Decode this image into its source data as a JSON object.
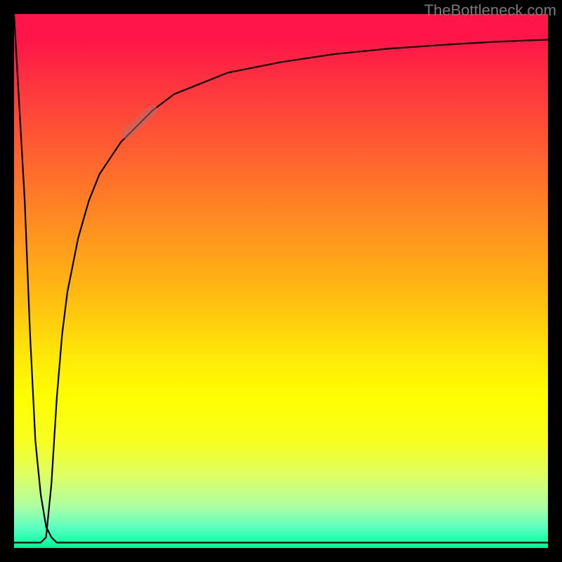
{
  "watermark": "TheBottleneck.com",
  "chart_data": {
    "type": "line",
    "title": "",
    "xlabel": "",
    "ylabel": "",
    "xlim": [
      0,
      100
    ],
    "ylim": [
      0,
      100
    ],
    "grid": false,
    "legend": false,
    "series": [
      {
        "name": "bottleneck-curve",
        "color": "#000000",
        "x": [
          0,
          2,
          3,
          4,
          5,
          6,
          7,
          8,
          9,
          10,
          12,
          14,
          16,
          18,
          20,
          23,
          26,
          30,
          35,
          40,
          50,
          60,
          70,
          80,
          90,
          100
        ],
        "y_down": [
          100,
          65,
          40,
          20,
          10,
          4,
          2,
          1,
          1,
          1,
          1,
          1,
          1,
          1,
          1,
          1,
          1,
          1,
          1,
          1,
          1,
          1,
          1,
          1,
          1,
          1
        ],
        "y_up": [
          1,
          1,
          1,
          1,
          1,
          2,
          12,
          28,
          40,
          48,
          58,
          65,
          70,
          73,
          76,
          79,
          82,
          85,
          87,
          89,
          91,
          92.5,
          93.5,
          94.2,
          94.8,
          95.2
        ]
      },
      {
        "name": "highlight-segment",
        "color_rgba": "rgba(180,110,110,0.55)",
        "x": [
          21,
          26
        ],
        "y": [
          77.5,
          82
        ]
      }
    ],
    "annotations": []
  },
  "colors": {
    "frame": "#000000",
    "curve": "#000000",
    "highlight": "rgba(180,110,110,0.55)"
  }
}
